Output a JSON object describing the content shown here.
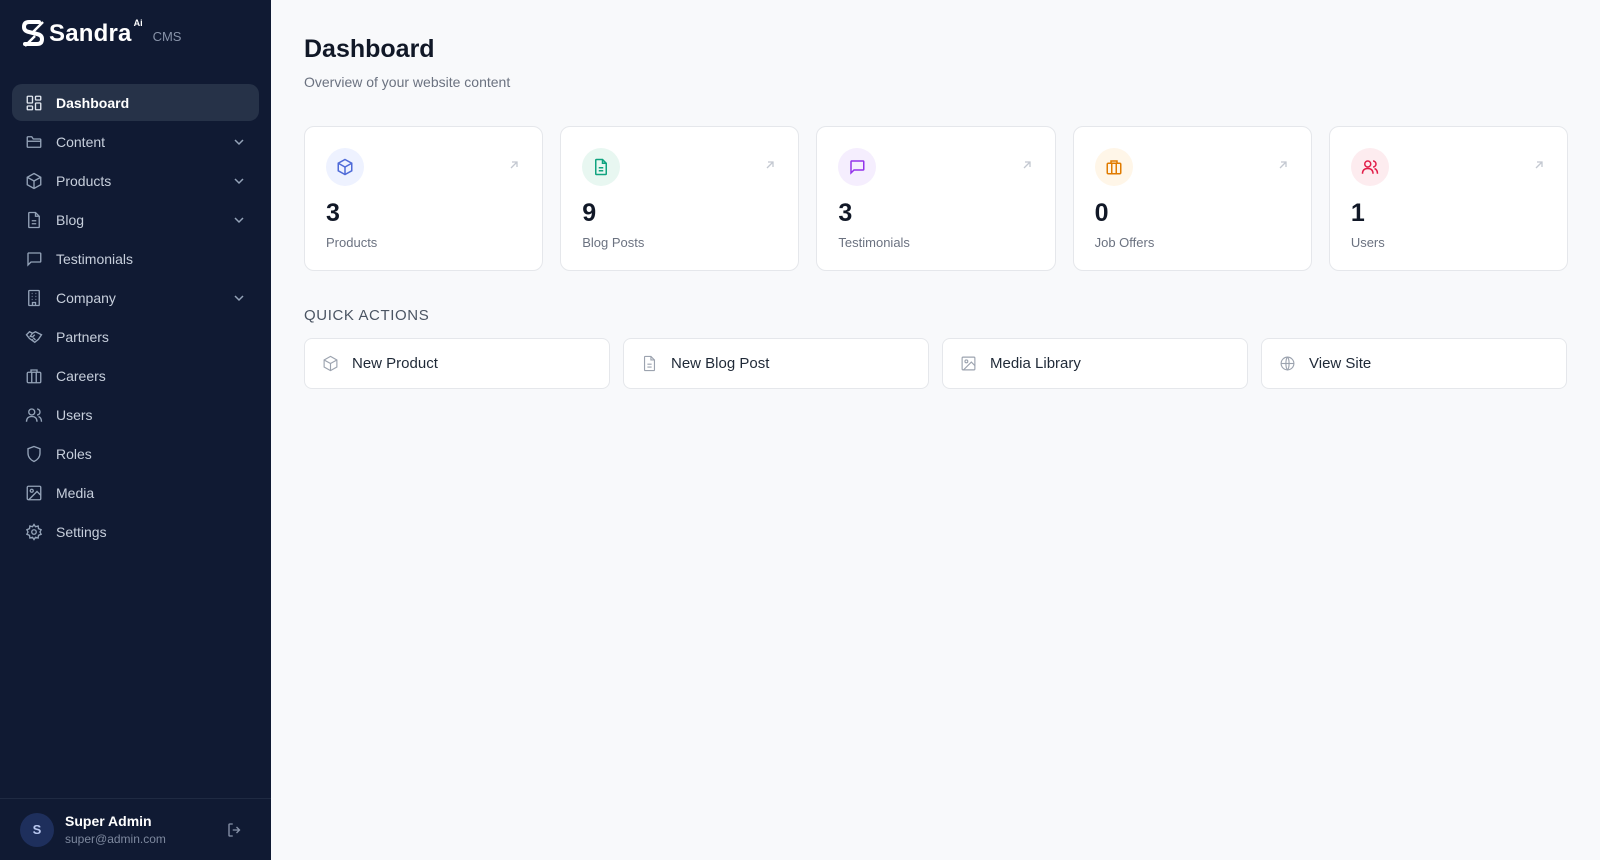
{
  "brand": {
    "name": "Sandra",
    "sup": "Ai",
    "tag": "CMS"
  },
  "sidebar": {
    "items": [
      {
        "label": "Dashboard",
        "icon": "dashboard-icon",
        "active": true,
        "expandable": false
      },
      {
        "label": "Content",
        "icon": "folder-icon",
        "active": false,
        "expandable": true
      },
      {
        "label": "Products",
        "icon": "box-icon",
        "active": false,
        "expandable": true
      },
      {
        "label": "Blog",
        "icon": "document-icon",
        "active": false,
        "expandable": true
      },
      {
        "label": "Testimonials",
        "icon": "chat-icon",
        "active": false,
        "expandable": false
      },
      {
        "label": "Company",
        "icon": "building-icon",
        "active": false,
        "expandable": true
      },
      {
        "label": "Partners",
        "icon": "handshake-icon",
        "active": false,
        "expandable": false
      },
      {
        "label": "Careers",
        "icon": "briefcase-icon",
        "active": false,
        "expandable": false
      },
      {
        "label": "Users",
        "icon": "users-icon",
        "active": false,
        "expandable": false
      },
      {
        "label": "Roles",
        "icon": "shield-icon",
        "active": false,
        "expandable": false
      },
      {
        "label": "Media",
        "icon": "image-icon",
        "active": false,
        "expandable": false
      },
      {
        "label": "Settings",
        "icon": "gear-icon",
        "active": false,
        "expandable": false
      }
    ],
    "user": {
      "initial": "S",
      "name": "Super Admin",
      "email": "super@admin.com"
    }
  },
  "main": {
    "title": "Dashboard",
    "subtitle": "Overview of your website content",
    "stats": [
      {
        "value": "3",
        "label": "Products",
        "icon": "box-icon",
        "color": "#4f6bd8",
        "bg": "#eef2ff"
      },
      {
        "value": "9",
        "label": "Blog Posts",
        "icon": "document-icon",
        "color": "#10a37f",
        "bg": "#e8f7f1"
      },
      {
        "value": "3",
        "label": "Testimonials",
        "icon": "chat-icon",
        "color": "#9333ea",
        "bg": "#f5eefe"
      },
      {
        "value": "0",
        "label": "Job Offers",
        "icon": "briefcase-icon",
        "color": "#e07b00",
        "bg": "#fff6e8"
      },
      {
        "value": "1",
        "label": "Users",
        "icon": "users-icon",
        "color": "#e11d48",
        "bg": "#fdecef"
      }
    ],
    "quick_actions_heading": "QUICK ACTIONS",
    "quick_actions": [
      {
        "label": "New Product",
        "icon": "box-icon"
      },
      {
        "label": "New Blog Post",
        "icon": "document-icon"
      },
      {
        "label": "Media Library",
        "icon": "image-icon"
      },
      {
        "label": "View Site",
        "icon": "globe-icon"
      }
    ]
  }
}
